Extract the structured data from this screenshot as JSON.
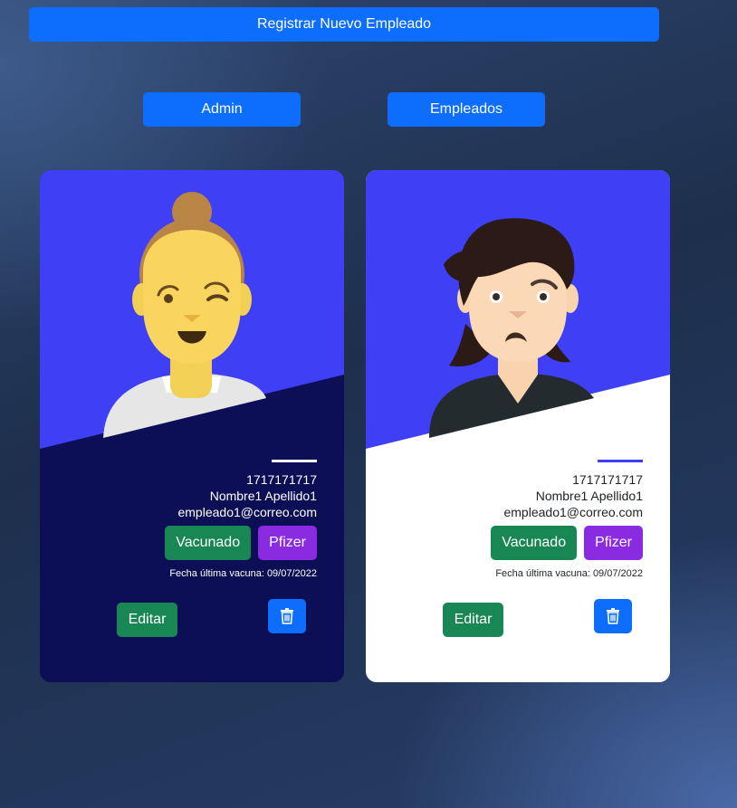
{
  "header": {
    "register_label": "Registrar Nuevo Empleado",
    "admin_label": "Admin",
    "empleados_label": "Empleados"
  },
  "cards": [
    {
      "id": "1717171717",
      "name": "Nombre1 Apellido1",
      "email": "empleado1@correo.com",
      "vaccine_status": "Vacunado",
      "vaccine_type": "Pfizer",
      "vaccine_date": "Fecha última vacuna: 09/07/2022",
      "edit_label": "Editar",
      "avatar_icon": "woman-winking-avatar",
      "theme": "dark"
    },
    {
      "id": "1717171717",
      "name": "Nombre1 Apellido1",
      "email": "empleado1@correo.com",
      "vaccine_status": "Vacunado",
      "vaccine_type": "Pfizer",
      "vaccine_date": "Fecha última vacuna: 09/07/2022",
      "edit_label": "Editar",
      "avatar_icon": "man-worried-avatar",
      "theme": "light"
    }
  ],
  "colors": {
    "primary": "#0d6efd",
    "success": "#198754",
    "purple": "#8a2be2",
    "card_top": "#3f3ff5",
    "card_dark": "#0c0f55",
    "card_light": "#ffffff"
  }
}
